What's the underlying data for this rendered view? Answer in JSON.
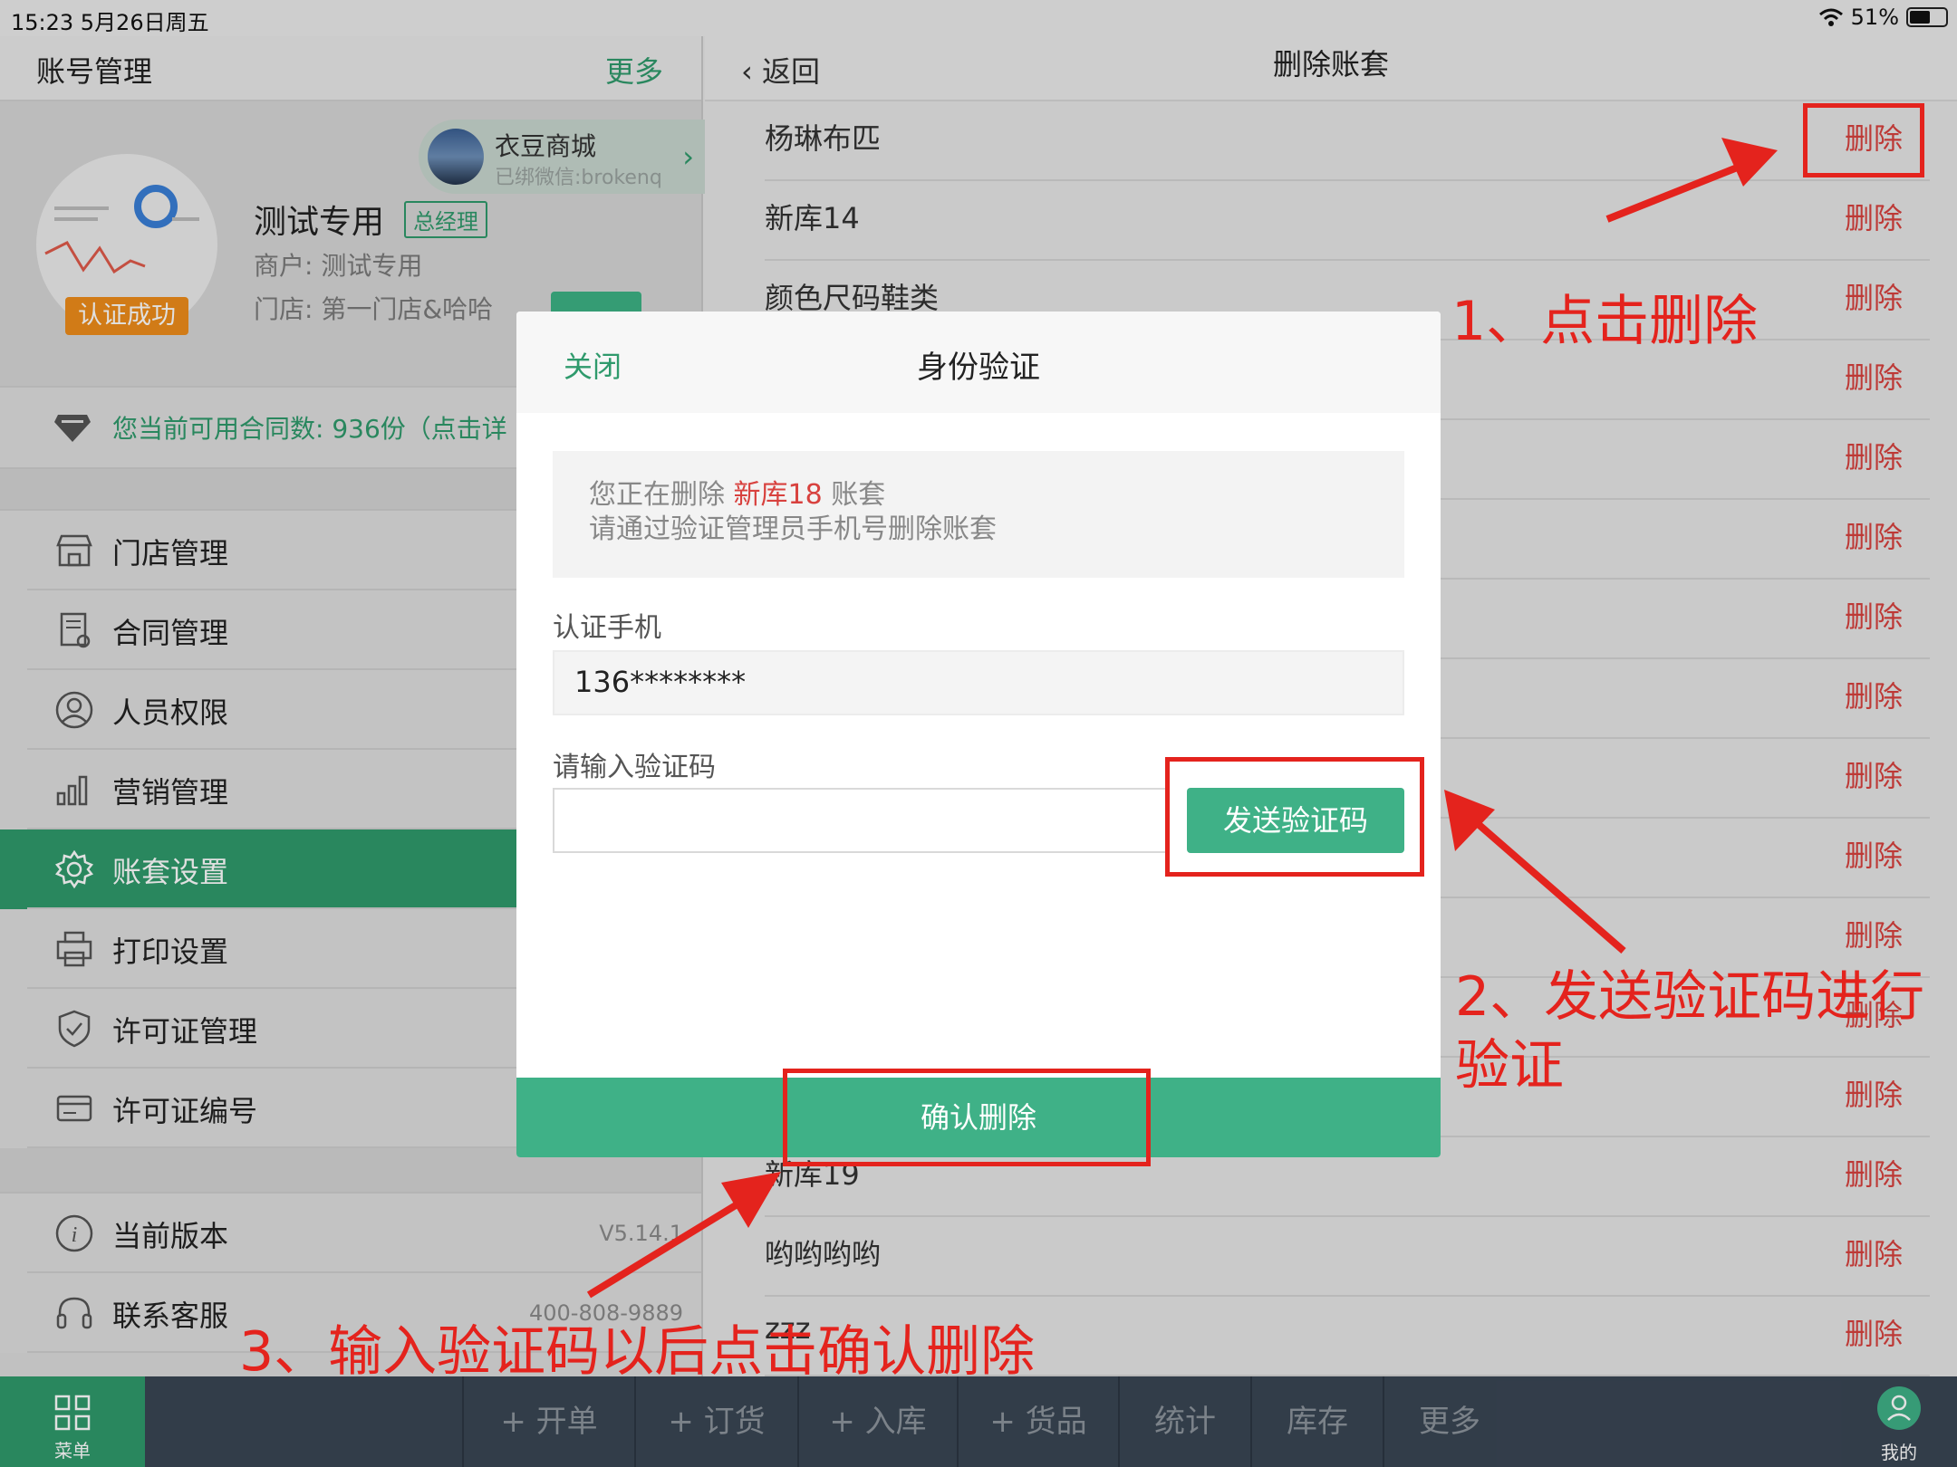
{
  "status_bar": {
    "time_date": "15:23   5月26日周五",
    "battery": "51%"
  },
  "left_panel": {
    "title": "账号管理",
    "more": "更多",
    "profile": {
      "verified_badge": "认证成功",
      "shop_name": "衣豆商城",
      "shop_sub": "已绑微信:brokenq",
      "user_name": "测试专用",
      "role": "总经理",
      "merchant": "商户:  测试专用",
      "store": "门店:  第一门店&哈哈"
    },
    "contract_notice": "您当前可用合同数:  936份（点击详",
    "menu": [
      {
        "label": "门店管理",
        "icon": "store-icon"
      },
      {
        "label": "合同管理",
        "icon": "contract-icon"
      },
      {
        "label": "人员权限",
        "icon": "user-icon"
      },
      {
        "label": "营销管理",
        "icon": "bar-chart-icon"
      },
      {
        "label": "账套设置",
        "icon": "gear-icon",
        "active": true
      },
      {
        "label": "打印设置",
        "icon": "printer-icon"
      },
      {
        "label": "许可证管理",
        "icon": "shield-icon"
      },
      {
        "label": "许可证编号",
        "icon": "card-icon"
      }
    ],
    "info": [
      {
        "label": "当前版本",
        "value": "V5.14.1",
        "icon": "info-icon"
      },
      {
        "label": "联系客服",
        "value": "400-808-9889",
        "icon": "headset-icon"
      }
    ]
  },
  "right_panel": {
    "back": "返回",
    "title": "删除账套",
    "delete_label": "删除",
    "accounts": [
      "杨琳布匹",
      "新库14",
      "颜色尺码鞋类",
      "",
      "",
      "",
      "",
      "",
      "",
      "",
      "",
      "",
      "",
      "新库19",
      "哟哟哟哟",
      "zzz"
    ]
  },
  "modal": {
    "close": "关闭",
    "title": "身份验证",
    "notice_prefix": "您正在删除 ",
    "notice_target": "新库18",
    "notice_suffix": " 账套",
    "notice_line2": "请通过验证管理员手机号删除账套",
    "phone_label": "认证手机",
    "phone_value": "136********",
    "code_label": "请输入验证码",
    "send_code": "发送验证码",
    "confirm": "确认删除"
  },
  "tabbar": {
    "menu_label": "菜单",
    "tabs": [
      "+ 开单",
      "+ 订货",
      "+ 入库",
      "+ 货品",
      "统计",
      "库存",
      "更多"
    ],
    "me_label": "我的"
  },
  "annotations": {
    "step1": "1、点击删除",
    "step2_line1": "2、发送验证码进行",
    "step2_line2": "验证",
    "step3": "3、输入验证码以后点击确认删除"
  },
  "colors": {
    "accent": "#2f9a6c",
    "button": "#3fb187",
    "danger": "#d8413e",
    "annotation": "#e4231d",
    "tabbar": "#3a4654"
  }
}
